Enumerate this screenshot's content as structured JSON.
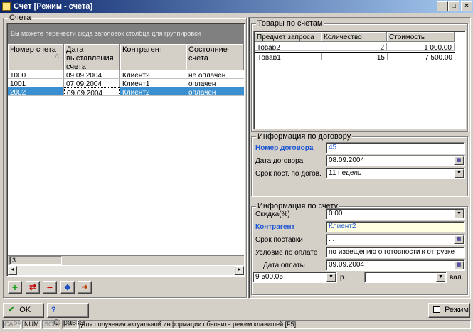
{
  "window": {
    "title": "Счет [Режим - счета]",
    "minimize": "_",
    "maximize": "□",
    "close": "×"
  },
  "left": {
    "group_title": "Счета",
    "group_hint": "Вы можете перенести сюда заголовок столбца для группировки",
    "columns": [
      "Номер счета",
      "Дата выставления счета",
      "Контрагент",
      "Состояние счета"
    ],
    "sort_indicator": "△",
    "rows": [
      [
        "1000",
        "09.09.2004",
        "Клиент2",
        "не оплачен"
      ],
      [
        "1001",
        "07.09.2004",
        "Клиент1",
        "оплачен"
      ],
      [
        "2002",
        "09.09.2004",
        "Клиент2",
        "оплачен"
      ]
    ],
    "selected_row": 2,
    "footer_count": "3",
    "scroll_left": "◄",
    "scroll_right": "►"
  },
  "goods": {
    "title": "Товары по счетам",
    "columns": [
      "Предмет запроса",
      "Количество",
      "Стоимость"
    ],
    "rows": [
      [
        "Товар2",
        "2",
        "1 000.00"
      ],
      [
        "Товар1",
        "15",
        "7 500.00"
      ]
    ]
  },
  "contract": {
    "title": "Информация по договору",
    "number_label": "Номер договора",
    "number_value": "45",
    "date_label": "Дата договора",
    "date_value": "08.09.2004",
    "term_label": "Срок пост. по догов.",
    "term_value": "11 недель"
  },
  "invoice": {
    "title": "Информация по счету",
    "discount_label": "Скидка(%)",
    "discount_value": "0.00",
    "counterparty_label": "Контрагент",
    "counterparty_value": "Клиент2",
    "delivery_label": "Срок поставки",
    "delivery_value": " . .",
    "payment_cond_label": "Условие по оплате",
    "payment_cond_value": "по извещению о готовности к отгрузке",
    "payment_date_label": "Дата оплаты",
    "payment_date_value": "09.09.2004",
    "sum_value": "9 500.05",
    "currency_label": "р.",
    "currency_value": "",
    "val_label": "вал."
  },
  "buttons": {
    "ok": "OK",
    "help": "Справка",
    "mode": "Режим",
    "ok_icon": "✔",
    "help_icon": "?"
  },
  "toolbar": {
    "add": "+",
    "swap": "⇄",
    "remove": "−",
    "refresh": "◆",
    "export": "➜"
  },
  "status": {
    "caps": "CAPS",
    "num": "NUM",
    "scrl": "SCRL",
    "ins": "INS",
    "message": "Для получения актуальной информации обновите режим клавишей [F5]"
  },
  "colors": {
    "selection": "#3a8fd0",
    "title_bar": "#0a246a",
    "accent_label": "#1c55d6",
    "highlight_field": "#ffffe1"
  },
  "icons": {
    "calendar": "calendar-icon",
    "dropdown": "chevron-down-icon"
  }
}
